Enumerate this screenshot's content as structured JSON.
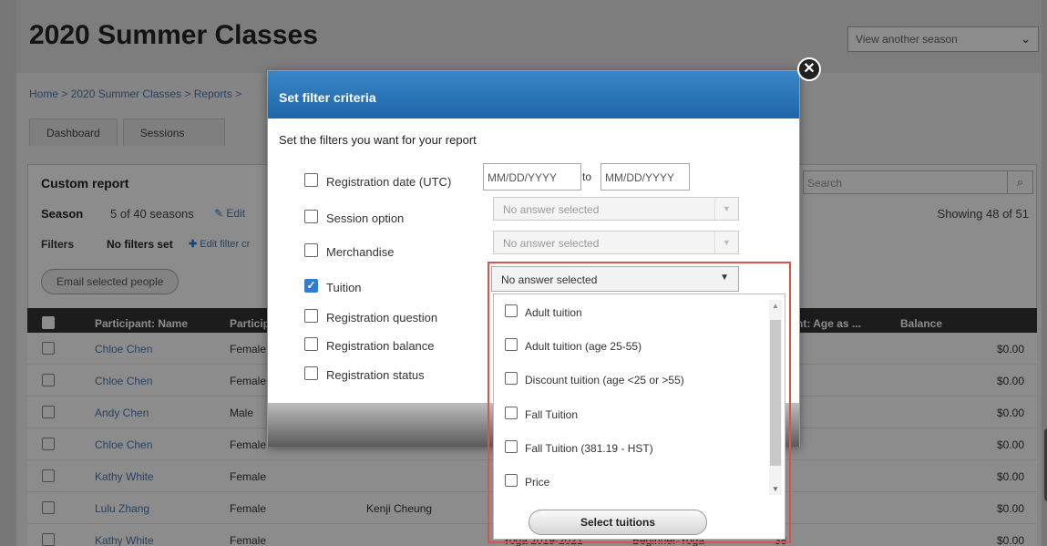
{
  "page": {
    "title": "2020 Summer Classes",
    "season_select": "View another season",
    "breadcrumb": "Home > 2020 Summer Classes > Reports >",
    "tabs": [
      "Dashboard",
      "Sessions"
    ]
  },
  "report": {
    "title": "Custom report",
    "season_label": "Season",
    "season_count": "5 of 40 seasons",
    "edit_label": "Edit",
    "filters_label": "Filters",
    "filters_value": "No filters set",
    "edit_filter_label": "Edit filter cr",
    "search_placeholder": "Search",
    "showing": "Showing 48 of 51",
    "email_button": "Email selected people",
    "columns": [
      "Participant: Name",
      "Particip",
      "pant: Age as ...",
      "Balance"
    ],
    "rows": [
      {
        "name": "Chloe Chen",
        "gender": "Female",
        "contact": "",
        "session": "",
        "level": "",
        "age": "",
        "balance": "$0.00"
      },
      {
        "name": "Chloe Chen",
        "gender": "Female",
        "contact": "",
        "session": "",
        "level": "",
        "age": "",
        "balance": "$0.00"
      },
      {
        "name": "Andy Chen",
        "gender": "Male",
        "contact": "",
        "session": "",
        "level": "",
        "age": "",
        "balance": "$0.00"
      },
      {
        "name": "Chloe Chen",
        "gender": "Female",
        "contact": "",
        "session": "",
        "level": "",
        "age": "",
        "balance": "$0.00"
      },
      {
        "name": "Kathy White",
        "gender": "Female",
        "contact": "",
        "session": "",
        "level": "",
        "age": "",
        "balance": "$0.00"
      },
      {
        "name": "Lulu Zhang",
        "gender": "Female",
        "contact": "Kenji Cheung",
        "session": "",
        "level": "",
        "age": "",
        "balance": "$0.00"
      },
      {
        "name": "Kathy White",
        "gender": "Female",
        "contact": "",
        "session": "Yoga 2019-2021",
        "level": "Beginner-Yoga",
        "age": "38",
        "balance": "$0.00"
      }
    ]
  },
  "modal": {
    "title": "Set filter criteria",
    "intro": "Set the filters you want for your report",
    "filters": [
      {
        "label": "Registration date (UTC)",
        "checked": false
      },
      {
        "label": "Session option",
        "checked": false
      },
      {
        "label": "Merchandise",
        "checked": false
      },
      {
        "label": "Tuition",
        "checked": true
      },
      {
        "label": "Registration question",
        "checked": false
      },
      {
        "label": "Registration balance",
        "checked": false
      },
      {
        "label": "Registration status",
        "checked": false
      }
    ],
    "date_from_placeholder": "MM/DD/YYYY",
    "date_to_label": "to",
    "date_to_placeholder": "MM/DD/YYYY",
    "session_option_value": "No answer selected",
    "merchandise_value": "No answer selected",
    "tuition_value": "No answer selected"
  },
  "tuition_dropdown": {
    "options": [
      "Adult tuition",
      "Adult tuition (age 25-55)",
      "Discount tuition (age <25 or >55)",
      "Fall Tuition",
      "Fall Tuition (381.19 - HST)",
      "Price"
    ],
    "button": "Select tuitions"
  },
  "colors": {
    "modal_header": "#2a76bb",
    "link": "#4a78b0",
    "highlight": "#d9534f",
    "checkbox_checked": "#2f7dd1"
  }
}
